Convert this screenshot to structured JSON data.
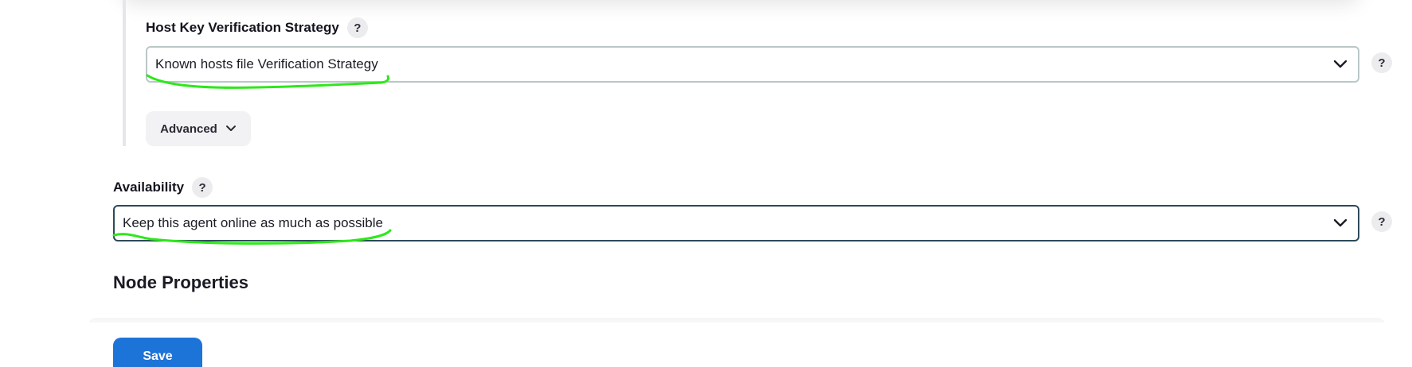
{
  "host_key": {
    "label": "Host Key Verification Strategy",
    "help": "?",
    "selected": "Known hosts file Verification Strategy",
    "side_help": "?"
  },
  "advanced": {
    "label": "Advanced"
  },
  "availability": {
    "label": "Availability",
    "help": "?",
    "selected": "Keep this agent online as much as possible",
    "side_help": "?"
  },
  "node_properties": {
    "heading": "Node Properties"
  },
  "footer": {
    "save_label": "Save"
  },
  "colors": {
    "primary_button": "#1d74d8",
    "annotation_marker": "#2ee81a",
    "select_border": "#b9c7c7",
    "select_border_focused": "#2e4a5a"
  },
  "icons": {
    "dropdown": "chevron-down-icon",
    "advanced": "chevron-down-icon"
  }
}
